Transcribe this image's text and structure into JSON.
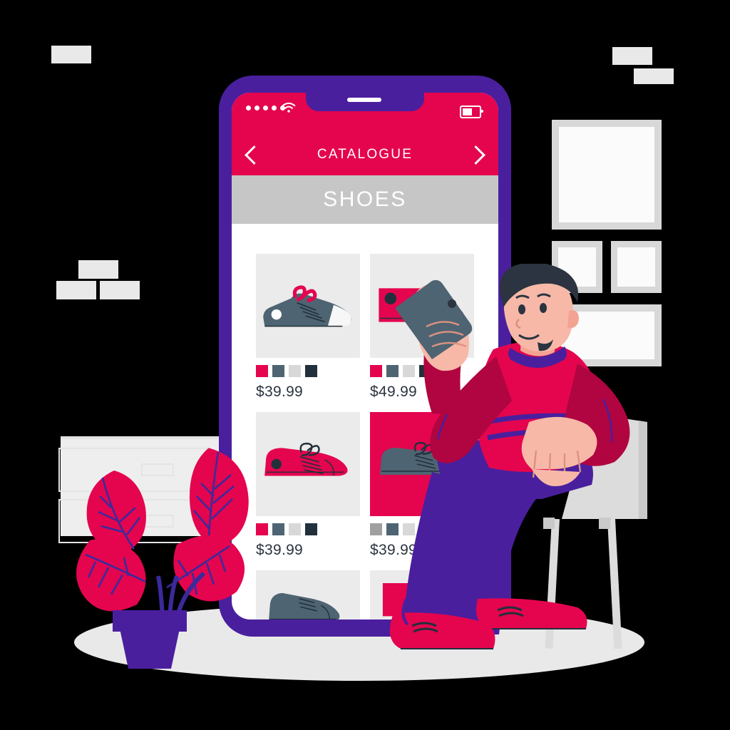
{
  "scene": {
    "title": "Mobile shoe shopping catalogue illustration",
    "palette": {
      "crimson": "#e4054e",
      "purple": "#4a1f9e",
      "slate": "#4e6472",
      "dark_navy": "#22303c",
      "light_gray": "#d8d8d8",
      "panel_gray": "#ebebeb",
      "header_gray": "#c6c6c6",
      "skin": "#f7b8a8",
      "hair": "#2b3440",
      "white": "#ffffff"
    }
  },
  "phone": {
    "status_bar": {
      "signal_icon": "signal-dots-icon",
      "signal_dots": 5,
      "wifi_icon": "wifi-icon",
      "battery_icon": "battery-icon",
      "speaker_icon": "earpiece-speaker"
    },
    "nav_bar": {
      "back_icon": "chevron-left-icon",
      "title": "CATALOGUE",
      "forward_icon": "chevron-right-icon"
    },
    "category_bar": {
      "label": "SHOES"
    },
    "products": [
      {
        "id": "p1",
        "price": "$39.99",
        "shoe": "low-top-sneaker",
        "shoe_color": "#4e6472",
        "tile_bg": "#ebebeb",
        "swatches": [
          "#e4054e",
          "#4e6472",
          "#d8d8d8",
          "#22303c"
        ]
      },
      {
        "id": "p2",
        "price": "$49.99",
        "shoe": "high-top-sneaker",
        "shoe_color": "#e4054e",
        "tile_bg": "#ebebeb",
        "swatches": [
          "#e4054e",
          "#4e6472",
          "#d8d8d8",
          "#22303c"
        ]
      },
      {
        "id": "p3",
        "price": "$39.99",
        "shoe": "lace-up-sneaker",
        "shoe_color": "#e4054e",
        "tile_bg": "#ebebeb",
        "swatches": [
          "#e4054e",
          "#4e6472",
          "#d8d8d8",
          "#22303c"
        ]
      },
      {
        "id": "p4",
        "price": "$39.99",
        "shoe": "slip-on-sneaker",
        "shoe_color": "#4e6472",
        "tile_bg": "#e4054e",
        "swatches": [
          "#a0a0a0",
          "#4e6472",
          "#d8d8d8",
          "#22303c"
        ]
      },
      {
        "id": "p5",
        "price": "",
        "shoe": "ankle-boot",
        "shoe_color": "#4e6472",
        "tile_bg": "#ebebeb",
        "swatches": []
      },
      {
        "id": "p6",
        "price": "",
        "shoe": "red-boot",
        "shoe_color": "#e4054e",
        "tile_bg": "#ebebeb",
        "swatches": []
      }
    ]
  },
  "background": {
    "wall_notes": [
      "note-top-left",
      "note-top-right-a",
      "note-top-right-b",
      "note-mid-a",
      "note-mid-b",
      "note-mid-c"
    ],
    "picture_frames": [
      "frame-large",
      "frame-small-left",
      "frame-small-right",
      "frame-wide"
    ],
    "cabinet": "filing-cabinet",
    "plant": "potted-plant",
    "floor": "floor-shadow-ellipse"
  },
  "character": {
    "name": "seated-man-with-phone",
    "holds": "smartphone",
    "seat": "stool"
  }
}
